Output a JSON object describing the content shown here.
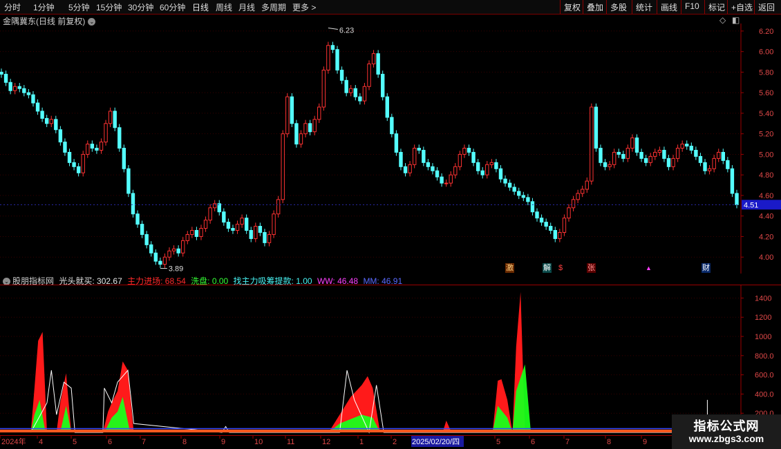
{
  "toolbar": {
    "periods": [
      "分时",
      "1分钟",
      "5分钟",
      "15分钟",
      "30分钟",
      "60分钟",
      "日线",
      "周线",
      "月线",
      "多周期",
      "更多"
    ],
    "active_period": "日线",
    "more_arrow": ">",
    "right_buttons": [
      "复权",
      "叠加",
      "多股",
      "统计",
      "画线",
      "F10",
      "标记",
      "+自选",
      "返回"
    ]
  },
  "price_header": {
    "stock_name": "金隅冀东",
    "mode": "(日线 前复权)",
    "dropdown_glyph": "⌄",
    "diamond_glyph": "◇",
    "window_glyph": "◧"
  },
  "indicator_header": {
    "name": "股朋指标网",
    "items": [
      {
        "label": "光头就买:",
        "value": "302.67",
        "color": "#e8e8e8"
      },
      {
        "label": "主力进场:",
        "value": "68.54",
        "color": "#ff2a2a"
      },
      {
        "label": "洗盘:",
        "value": "0.00",
        "color": "#35ff35"
      },
      {
        "label": "找主力吸筹提款:",
        "value": "1.00",
        "color": "#49f5f5"
      },
      {
        "label": "WW:",
        "value": "46.48",
        "color": "#ff40ff"
      },
      {
        "label": "MM:",
        "value": "46.91",
        "color": "#5a6aff"
      }
    ]
  },
  "price_axis": {
    "labels": [
      "6.20",
      "6.00",
      "5.80",
      "5.60",
      "5.40",
      "5.20",
      "5.00",
      "4.80",
      "4.60",
      "4.40",
      "4.20",
      "4.00"
    ],
    "min": 3.84,
    "max": 6.26,
    "current": "4.51"
  },
  "indicator_axis": {
    "labels": [
      "1400",
      "1200",
      "1000",
      "800.0",
      "600.0",
      "400.0",
      "200.0"
    ],
    "min": 0,
    "max": 1540
  },
  "annotations": {
    "high": "6.23",
    "low": "3.89"
  },
  "events": [
    {
      "text": "激",
      "bg": "#6a2a00",
      "color": "#ffd080"
    },
    {
      "text": "解",
      "bg": "#0a4a4a",
      "color": "#ffffff"
    },
    {
      "text": "$",
      "bg": "#000000",
      "color": "#ff4040"
    },
    {
      "text": "张",
      "bg": "#5a0000",
      "color": "#ff9090"
    },
    {
      "text": "▲",
      "bg": "#000000",
      "color": "#ff40ff"
    },
    {
      "text": "财",
      "bg": "#0a2a6a",
      "color": "#ffffff"
    }
  ],
  "date_axis": {
    "labels": [
      "2024年",
      "4",
      "5",
      "6",
      "7",
      "8",
      "9",
      "10",
      "11",
      "12",
      "1",
      "2",
      "2025/02/20/四",
      "5",
      "6",
      "7",
      "8",
      "9"
    ],
    "highlight": "2025/02/20/四"
  },
  "watermark": {
    "line1": "指标公式网",
    "line2": "www.zbgs3.com"
  },
  "colors": {
    "up": "#ff3232",
    "down": "#54ffff",
    "grid": "#3a0000",
    "frame": "#9c0000",
    "axis_text": "#e04848",
    "zhuli": "#ff1a1a",
    "xipan": "#1aff1a",
    "guangtou": "#ffffff",
    "ww": "#ff40ff",
    "mm": "#3a4aff"
  },
  "chart_data": {
    "type": "candlestick",
    "x_range": [
      "2024-03",
      "2025-09"
    ],
    "price_ylim": [
      3.84,
      6.26
    ],
    "close_path": [
      5.78,
      5.7,
      5.62,
      5.66,
      5.64,
      5.6,
      5.58,
      5.5,
      5.42,
      5.35,
      5.3,
      5.34,
      5.24,
      5.12,
      5.02,
      4.92,
      4.88,
      4.82,
      5.0,
      5.1,
      5.06,
      5.04,
      5.12,
      5.3,
      5.42,
      5.26,
      5.06,
      4.86,
      4.62,
      4.42,
      4.32,
      4.22,
      4.12,
      4.04,
      3.96,
      3.93,
      4.0,
      4.06,
      4.08,
      4.04,
      4.16,
      4.22,
      4.26,
      4.2,
      4.28,
      4.36,
      4.48,
      4.52,
      4.44,
      4.34,
      4.28,
      4.26,
      4.32,
      4.38,
      4.26,
      4.18,
      4.3,
      4.24,
      4.14,
      4.22,
      4.42,
      4.56,
      5.2,
      5.56,
      5.3,
      5.1,
      5.2,
      5.3,
      5.22,
      5.34,
      5.46,
      5.82,
      6.06,
      6.02,
      5.82,
      5.72,
      5.6,
      5.64,
      5.56,
      5.52,
      5.66,
      5.88,
      5.98,
      5.78,
      5.56,
      5.36,
      5.2,
      5.02,
      4.88,
      4.82,
      4.9,
      5.06,
      5.04,
      4.92,
      4.88,
      4.84,
      4.78,
      4.72,
      4.72,
      4.8,
      4.88,
      5.0,
      5.06,
      5.02,
      4.92,
      4.84,
      4.8,
      4.9,
      4.92,
      4.86,
      4.76,
      4.72,
      4.68,
      4.64,
      4.6,
      4.58,
      4.54,
      4.44,
      4.38,
      4.34,
      4.3,
      4.26,
      4.18,
      4.24,
      4.38,
      4.48,
      4.56,
      4.62,
      4.66,
      4.74,
      5.46,
      5.06,
      4.92,
      4.88,
      4.9,
      5.02,
      5.0,
      4.96,
      5.06,
      5.16,
      5.02,
      4.96,
      4.92,
      4.98,
      5.02,
      5.04,
      4.96,
      4.88,
      4.96,
      5.06,
      5.1,
      5.08,
      5.04,
      4.98,
      4.92,
      4.84,
      4.86,
      4.96,
      5.02,
      4.94,
      4.86,
      4.62,
      4.51
    ],
    "indicator_ylim": [
      0,
      1540
    ],
    "zhuli_jinchang": [
      [
        0.04,
        0.0
      ],
      [
        0.045,
        0.3
      ],
      [
        0.05,
        0.62
      ],
      [
        0.056,
        0.68
      ],
      [
        0.062,
        0.0
      ],
      [
        0.075,
        0.0
      ],
      [
        0.08,
        0.2
      ],
      [
        0.088,
        0.4
      ],
      [
        0.095,
        0.0
      ],
      [
        0.138,
        0.0
      ],
      [
        0.145,
        0.14
      ],
      [
        0.15,
        0.2
      ],
      [
        0.158,
        0.28
      ],
      [
        0.165,
        0.48
      ],
      [
        0.172,
        0.42
      ],
      [
        0.18,
        0.0
      ],
      [
        0.445,
        0.0
      ],
      [
        0.46,
        0.12
      ],
      [
        0.475,
        0.24
      ],
      [
        0.49,
        0.32
      ],
      [
        0.498,
        0.38
      ],
      [
        0.505,
        0.3
      ],
      [
        0.515,
        0.0
      ],
      [
        0.6,
        0.0
      ],
      [
        0.605,
        0.08
      ],
      [
        0.612,
        0.0
      ],
      [
        0.668,
        0.0
      ],
      [
        0.675,
        0.35
      ],
      [
        0.68,
        0.36
      ],
      [
        0.688,
        0.22
      ],
      [
        0.695,
        0.0
      ],
      [
        0.695,
        0.0
      ],
      [
        0.7,
        0.58
      ],
      [
        0.706,
        0.95
      ],
      [
        0.712,
        0.0
      ]
    ],
    "xipan": [
      [
        0.04,
        0.0
      ],
      [
        0.045,
        0.12
      ],
      [
        0.052,
        0.22
      ],
      [
        0.06,
        0.0
      ],
      [
        0.08,
        0.0
      ],
      [
        0.088,
        0.18
      ],
      [
        0.095,
        0.0
      ],
      [
        0.14,
        0.0
      ],
      [
        0.15,
        0.1
      ],
      [
        0.158,
        0.14
      ],
      [
        0.165,
        0.24
      ],
      [
        0.175,
        0.0
      ],
      [
        0.445,
        0.0
      ],
      [
        0.46,
        0.06
      ],
      [
        0.49,
        0.12
      ],
      [
        0.505,
        0.1
      ],
      [
        0.515,
        0.0
      ],
      [
        0.668,
        0.0
      ],
      [
        0.675,
        0.18
      ],
      [
        0.688,
        0.1
      ],
      [
        0.695,
        0.0
      ],
      [
        0.7,
        0.28
      ],
      [
        0.712,
        0.46
      ],
      [
        0.72,
        0.0
      ]
    ],
    "guangtou_jiumai": [
      [
        0.04,
        0.0
      ],
      [
        0.062,
        0.2
      ],
      [
        0.068,
        0.42
      ],
      [
        0.075,
        0.12
      ],
      [
        0.085,
        0.34
      ],
      [
        0.095,
        0.3
      ],
      [
        0.1,
        0.0
      ],
      [
        0.138,
        0.0
      ],
      [
        0.14,
        0.3
      ],
      [
        0.15,
        0.2
      ],
      [
        0.158,
        0.34
      ],
      [
        0.165,
        0.38
      ],
      [
        0.172,
        0.42
      ],
      [
        0.18,
        0.06
      ],
      [
        0.3,
        0.0
      ],
      [
        0.305,
        0.04
      ],
      [
        0.31,
        0.0
      ],
      [
        0.46,
        0.0
      ],
      [
        0.47,
        0.42
      ],
      [
        0.48,
        0.22
      ],
      [
        0.5,
        0.0
      ],
      [
        0.51,
        0.32
      ],
      [
        0.52,
        0.0
      ],
      [
        0.96,
        0.0
      ],
      [
        0.96,
        0.22
      ]
    ],
    "ww": 46.48,
    "mm": 46.91
  }
}
